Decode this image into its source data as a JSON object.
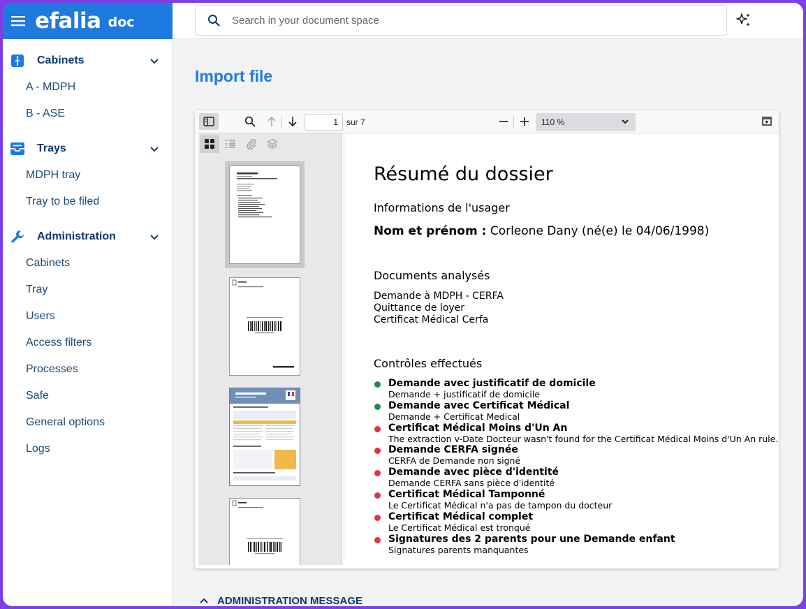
{
  "brand": {
    "logo": "efalia",
    "sub": "doc",
    "color": "#1f7ae0"
  },
  "header": {
    "search_placeholder": "Search in your document space"
  },
  "sidebar": {
    "sections": [
      {
        "label": "Cabinets",
        "icon": "cabinet-icon",
        "items": [
          "A - MDPH",
          "B - ASE"
        ]
      },
      {
        "label": "Trays",
        "icon": "tray-icon",
        "items": [
          "MDPH tray",
          "Tray to be filed"
        ]
      },
      {
        "label": "Administration",
        "icon": "wrench-icon",
        "items": [
          "Cabinets",
          "Tray",
          "Users",
          "Access filters",
          "Processes",
          "Safe",
          "General options",
          "Logs"
        ]
      }
    ]
  },
  "main": {
    "title": "Import file",
    "admin_message": "ADMINISTRATION MESSAGE"
  },
  "viewer": {
    "page_number": "1",
    "page_total_label": "sur 7",
    "zoom": "110 %",
    "document": {
      "title": "Résumé du dossier",
      "section_user": "Informations de l'usager",
      "name_label": "Nom et prénom :",
      "name_value": "Corleone Dany (né(e) le 04/06/1998)",
      "section_docs": "Documents analysés",
      "docs": [
        "Demande à MDPH - CERFA",
        "Quittance de loyer",
        "Certificat Médical Cerfa"
      ],
      "section_controls": "Contrôles effectués",
      "controls": [
        {
          "title": "Demande avec justificatif de domicile",
          "desc": "Demande + justificatif de domicile",
          "status": "ok"
        },
        {
          "title": "Demande avec Certificat Médical",
          "desc": "Demande + Certificat Medical",
          "status": "ok"
        },
        {
          "title": "Certificat Médical Moins d'Un An",
          "desc": "The extraction v-Date Docteur wasn't found for the Certificat Médical Moins d'Un An rule.",
          "status": "error"
        },
        {
          "title": "Demande CERFA signée",
          "desc": "CERFA de Demande non signé",
          "status": "error"
        },
        {
          "title": "Demande avec pièce d'identité",
          "desc": "Demande CERFA sans pièce d'identité",
          "status": "error"
        },
        {
          "title": "Certificat Médical Tamponné",
          "desc": "Le Certificat Médical n'a pas de tampon du docteur",
          "status": "error"
        },
        {
          "title": "Certificat Médical complet",
          "desc": "Le Certificat Médical est tronqué",
          "status": "error"
        },
        {
          "title": "Signatures des 2 parents pour une Demande enfant",
          "desc": "Signatures parents manquantes",
          "status": "error"
        }
      ]
    },
    "status_colors": {
      "ok": "#1f8a4c",
      "error": "#dc3545"
    }
  }
}
